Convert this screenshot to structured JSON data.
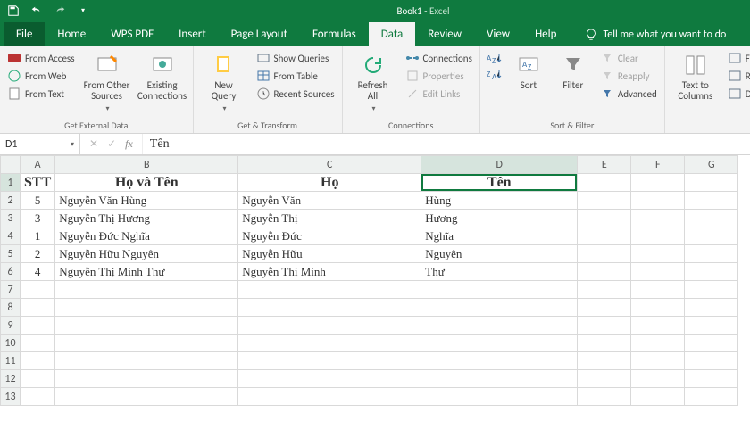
{
  "title": {
    "doc": "Book1",
    "suffix": " - Excel"
  },
  "tabs": [
    "File",
    "Home",
    "WPS PDF",
    "Insert",
    "Page Layout",
    "Formulas",
    "Data",
    "Review",
    "View",
    "Help"
  ],
  "active_tab": "Data",
  "tellme": "Tell me what you want to do",
  "ribbon": {
    "ext": {
      "access": "From Access",
      "web": "From Web",
      "text": "From Text",
      "other": "From Other\nSources",
      "existing": "Existing\nConnections",
      "group": "Get External Data"
    },
    "gt": {
      "nq": "New\nQuery",
      "show": "Show Queries",
      "table": "From Table",
      "recent": "Recent Sources",
      "group": "Get & Transform"
    },
    "conn": {
      "refresh": "Refresh\nAll",
      "connections": "Connections",
      "properties": "Properties",
      "edit": "Edit Links",
      "group": "Connections"
    },
    "sf": {
      "sort": "Sort",
      "filter": "Filter",
      "clear": "Clear",
      "reapply": "Reapply",
      "advanced": "Advanced",
      "group": "Sort & Filter"
    },
    "dt": {
      "ttc": "Text to\nColumns",
      "flash": "Flash",
      "rem": "Rem",
      "data": "Data"
    }
  },
  "namebox": "D1",
  "formula": "Tên",
  "columns": [
    "A",
    "B",
    "C",
    "D",
    "E",
    "F",
    "G"
  ],
  "headers": {
    "A": "STT",
    "B": "Họ và Tên",
    "C": "Họ",
    "D": "Tên"
  },
  "rows": [
    {
      "A": "5",
      "B": "Nguyễn Văn Hùng",
      "C": "Nguyễn Văn",
      "D": "Hùng"
    },
    {
      "A": "3",
      "B": "Nguyễn Thị Hương",
      "C": "Nguyễn Thị",
      "D": "Hương"
    },
    {
      "A": "1",
      "B": "Nguyễn Đức Nghĩa",
      "C": "Nguyễn Đức",
      "D": "Nghĩa"
    },
    {
      "A": "2",
      "B": "Nguyễn Hữu Nguyên",
      "C": "Nguyễn Hữu",
      "D": "Nguyên"
    },
    {
      "A": "4",
      "B": "Nguyễn Thị Minh Thư",
      "C": "Nguyễn Thị Minh",
      "D": "Thư"
    }
  ],
  "row_count_display": 13
}
